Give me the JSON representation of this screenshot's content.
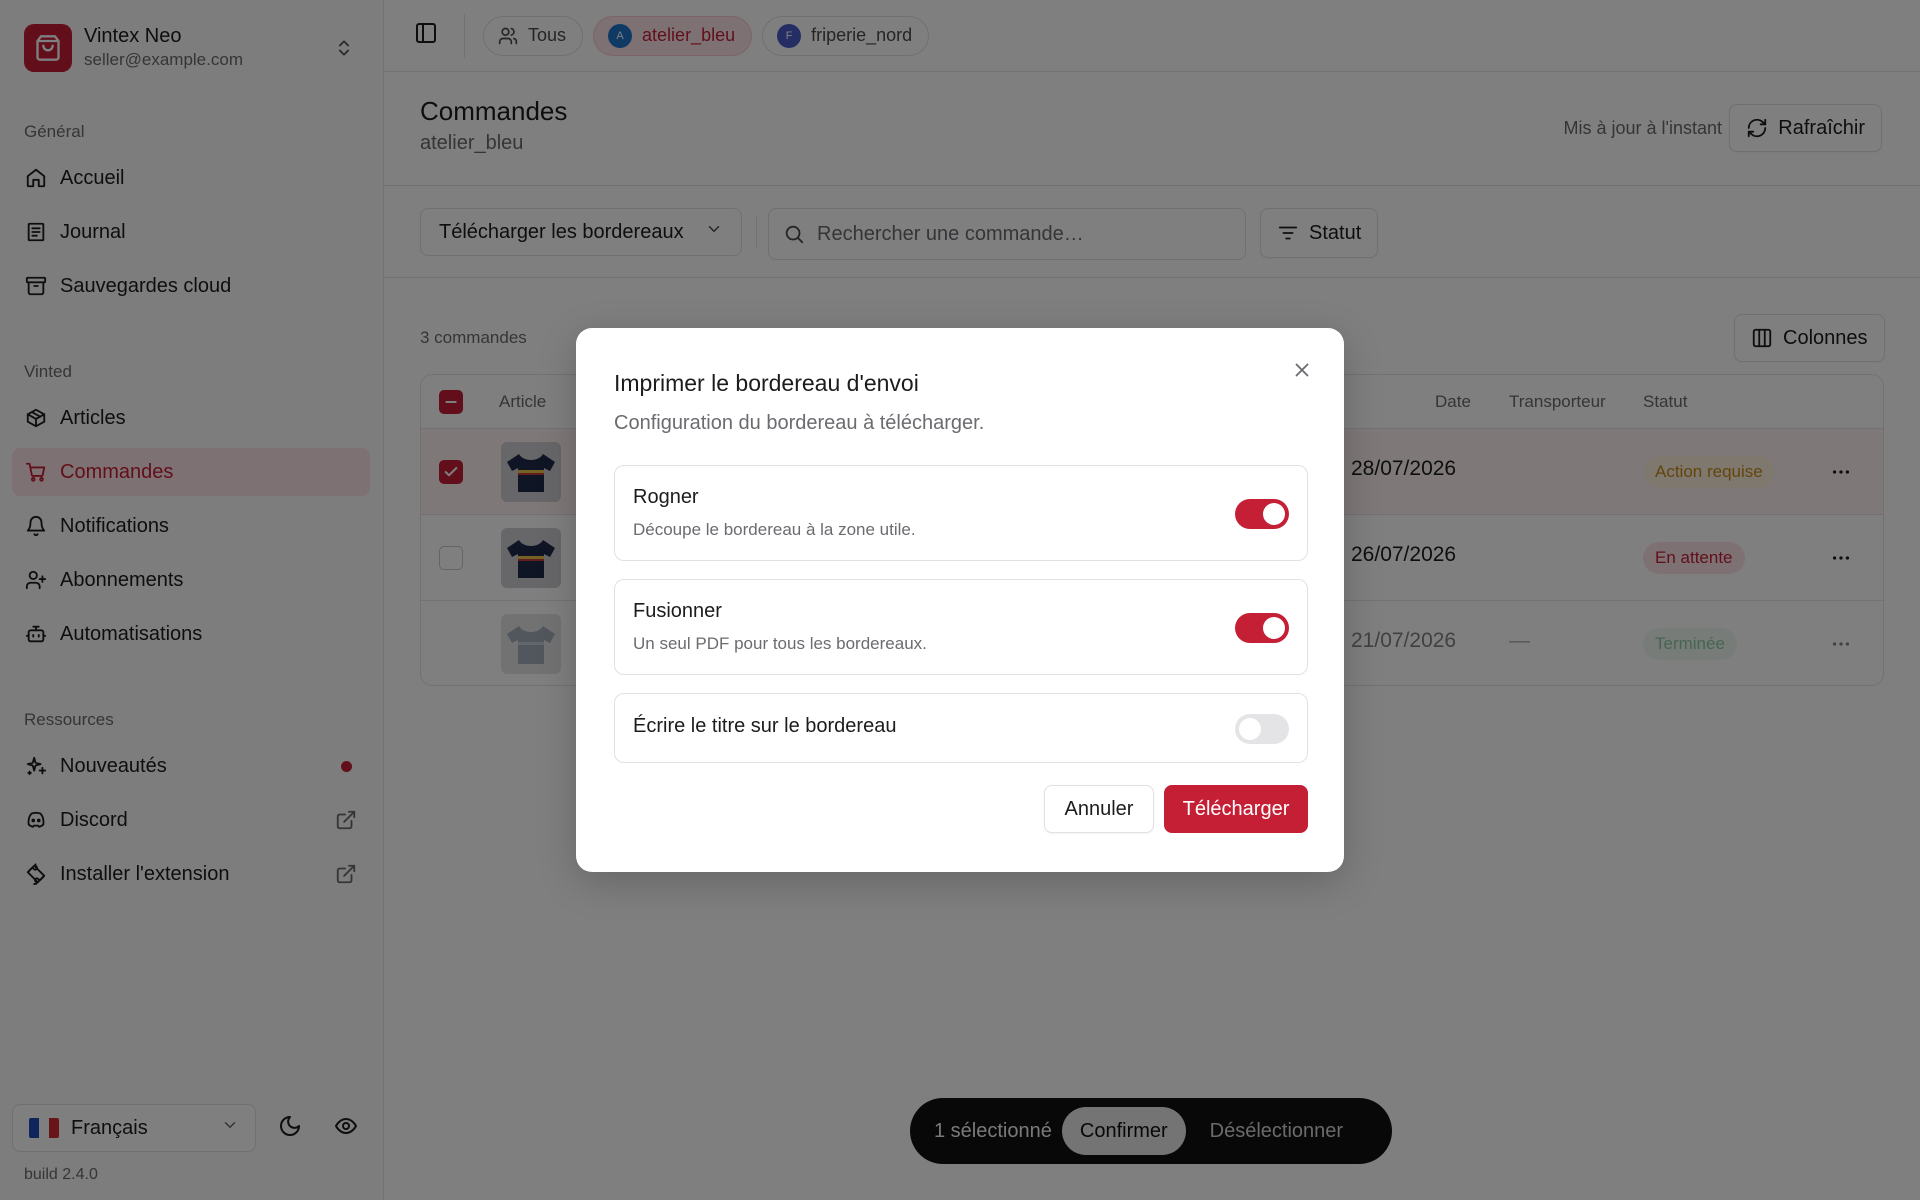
{
  "colors": {
    "accent": "#c51f36",
    "accent_soft": "#fbe3e6",
    "text": "#1c1c1e",
    "muted": "#6b6b70"
  },
  "brand": {
    "name": "Vintex Neo",
    "email": "seller@example.com"
  },
  "sidebar": {
    "sections": [
      {
        "label": "Général",
        "items": [
          {
            "label": "Accueil",
            "icon": "home-icon"
          },
          {
            "label": "Journal",
            "icon": "journal-icon"
          },
          {
            "label": "Sauvegardes cloud",
            "icon": "archive-icon"
          }
        ]
      },
      {
        "label": "Vinted",
        "items": [
          {
            "label": "Articles",
            "icon": "package-icon"
          },
          {
            "label": "Commandes",
            "icon": "cart-icon",
            "active": true
          },
          {
            "label": "Notifications",
            "icon": "bell-icon"
          },
          {
            "label": "Abonnements",
            "icon": "user-plus-icon"
          },
          {
            "label": "Automatisations",
            "icon": "bot-icon"
          }
        ]
      },
      {
        "label": "Ressources",
        "items": [
          {
            "label": "Nouveautés",
            "icon": "sparkles-icon"
          },
          {
            "label": "Discord",
            "icon": "discord-icon"
          },
          {
            "label": "Installer l'extension",
            "icon": "puzzle-icon"
          }
        ]
      }
    ],
    "language": "Français",
    "build": "build 2.4.0"
  },
  "topbar": {
    "chips": [
      {
        "label": "Tous"
      },
      {
        "label": "atelier_bleu",
        "initial": "A",
        "active": true
      },
      {
        "label": "friperie_nord",
        "initial": "F"
      }
    ]
  },
  "page": {
    "title": "Commandes",
    "subtitle": "atelier_bleu",
    "updated": "Mis à jour à l'instant",
    "refresh_label": "Rafraîchir"
  },
  "toolbar": {
    "download_dropdown": "Télécharger les bordereaux",
    "search_placeholder": "Rechercher une commande…",
    "status_filter": "Statut"
  },
  "table": {
    "count": "3 commandes",
    "columns_button": "Colonnes",
    "headers": {
      "article": "Article",
      "date": "Date",
      "carrier": "Transporteur",
      "status": "Statut"
    },
    "rows": [
      {
        "selected": true,
        "date": "28/07/2026",
        "carrier": "",
        "status": "Action requise",
        "status_color": "#e2a12a"
      },
      {
        "selected": false,
        "date": "26/07/2026",
        "carrier": "",
        "status": "En attente",
        "status_color": "#c51f36"
      },
      {
        "selected": false,
        "date": "21/07/2026",
        "carrier": "—",
        "status": "Terminée",
        "status_color": "#2f9e5b"
      }
    ]
  },
  "actionbar": {
    "count": "1 sélectionné",
    "confirm": "Confirmer",
    "clear": "Désélectionner"
  },
  "modal": {
    "title": "Imprimer le bordereau d'envoi",
    "description": "Configuration du bordereau à télécharger.",
    "options": [
      {
        "title": "Rogner",
        "desc": "Découpe le bordereau à la zone utile.",
        "enabled": true
      },
      {
        "title": "Fusionner",
        "desc": "Un seul PDF pour tous les bordereaux.",
        "enabled": true
      },
      {
        "title": "Écrire le titre sur le bordereau",
        "desc": "",
        "enabled": false
      }
    ],
    "cancel": "Annuler",
    "confirm": "Télécharger"
  }
}
